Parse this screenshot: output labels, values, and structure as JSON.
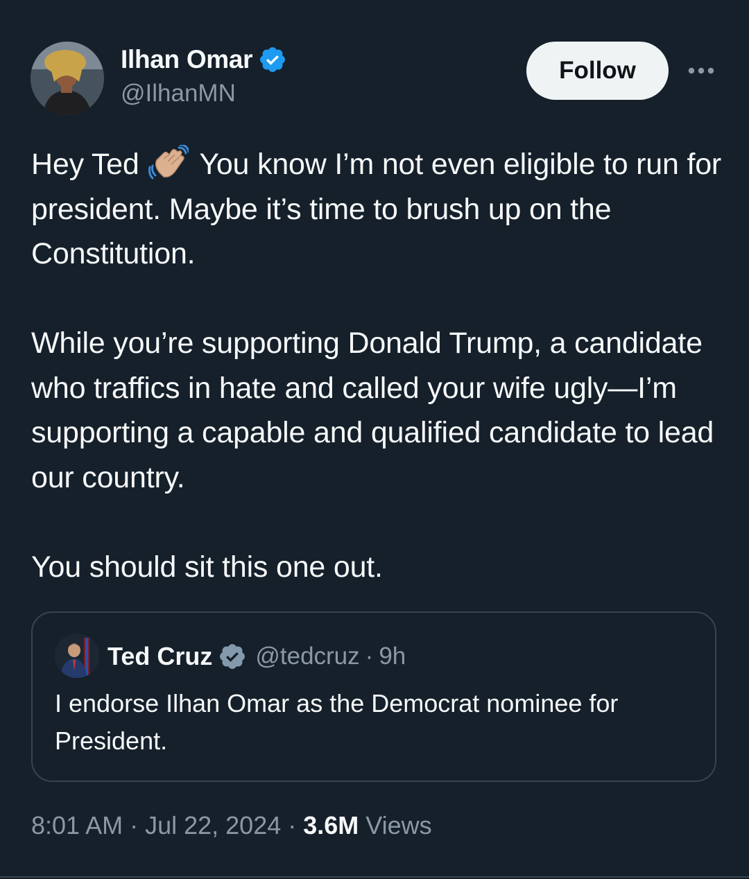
{
  "author": {
    "display_name": "Ilhan Omar",
    "handle": "@IlhanMN",
    "verified": true
  },
  "header": {
    "follow_label": "Follow"
  },
  "tweet": {
    "line1_before_emoji": "Hey Ted",
    "emoji": "waving-hand-medium-light-skin",
    "paragraph1_after_emoji": "You know I’m not even eligible to run for president. Maybe it’s time to brush up on the Constitution.",
    "paragraph2": "While you’re supporting Donald Trump, a candidate who traffics in hate and called your wife ugly—I’m supporting a capable and qualified candidate to lead our country.",
    "paragraph3": "You should sit this one out."
  },
  "quoted_tweet": {
    "display_name": "Ted Cruz",
    "handle": "@tedcruz",
    "separator": "·",
    "time": "9h",
    "verified_badge": "gray",
    "text": "I endorse Ilhan Omar as the Democrat nominee for President."
  },
  "meta": {
    "time": "8:01 AM",
    "separator": "·",
    "date": "Jul 22, 2024",
    "views_count": "3.6M",
    "views_label": "Views"
  },
  "colors": {
    "background": "#15202b",
    "text_primary": "#f7f9f9",
    "text_secondary": "#8b98a5",
    "verified_blue": "#1d9bf0",
    "verified_gray": "#829aab",
    "border": "#38444d"
  }
}
